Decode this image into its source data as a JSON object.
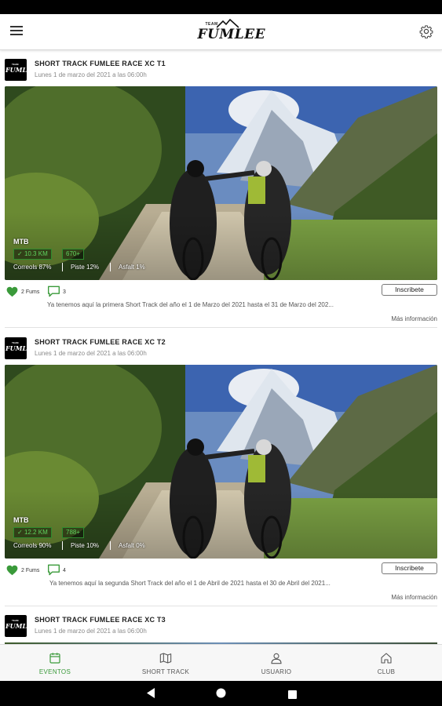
{
  "app": {
    "logo_tag": "TEAM",
    "logo_word": "FUMLEE",
    "menu_icon": "hamburger-menu-icon",
    "settings_icon": "gear-icon"
  },
  "colors": {
    "accent": "#3a9a3a",
    "metric_text": "#5fd35f",
    "metric_border": "#2e8b2e"
  },
  "events": [
    {
      "avatar_tag": "TEAM",
      "avatar_word": "FUMLEE",
      "title": "SHORT TRACK FUMLEE RACE XC T1",
      "date": "Lunes 1 de marzo del 2021 a las 06:00h",
      "sport": "MTB",
      "distance": "10.3 KM",
      "elevation": "670+",
      "terrain": [
        "Correols 87%",
        "Piste 12%",
        "Asfalt 1%"
      ],
      "likes": "2 Fums",
      "comments": "3",
      "join_label": "Inscribete",
      "description": "Ya tenemos aquí la primera Short Track del año el 1 de Marzo del 2021 hasta el 31 de Marzo del 202...",
      "more_label": "Más información"
    },
    {
      "avatar_tag": "TEAM",
      "avatar_word": "FUMLEE",
      "title": "SHORT TRACK FUMLEE RACE XC T2",
      "date": "Lunes 1 de marzo del 2021 a las 06:00h",
      "sport": "MTB",
      "distance": "12.2 KM",
      "elevation": "788+",
      "terrain": [
        "Correols 90%",
        "Piste 10%",
        "Asfalt 0%"
      ],
      "likes": "2 Fums",
      "comments": "4",
      "join_label": "Inscribete",
      "description": "Ya tenemos aquí la segunda Short Track del año el 1 de Abril de 2021 hasta el 30 de Abril del 2021...",
      "more_label": "Más información"
    },
    {
      "avatar_tag": "TEAM",
      "avatar_word": "FUMLEE",
      "title": "SHORT TRACK FUMLEE RACE XC T3",
      "date": "Lunes 1 de marzo del 2021 a las 06:00h"
    }
  ],
  "bottom_nav": [
    {
      "label": "EVENTOS",
      "icon": "calendar-icon",
      "active": true
    },
    {
      "label": "SHORT TRACK",
      "icon": "map-icon",
      "active": false
    },
    {
      "label": "USUARIO",
      "icon": "user-icon",
      "active": false
    },
    {
      "label": "CLUB",
      "icon": "home-icon",
      "active": false
    }
  ],
  "system_nav": [
    "back-icon",
    "home-circle-icon",
    "recents-icon"
  ]
}
